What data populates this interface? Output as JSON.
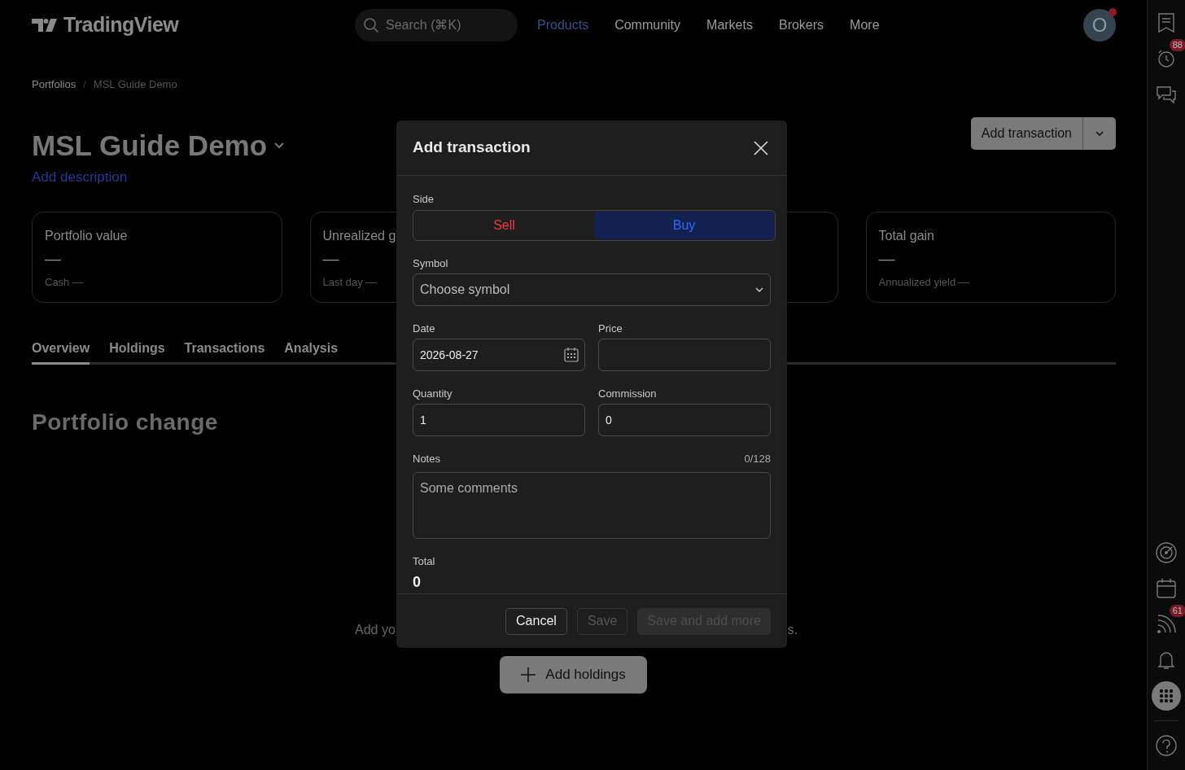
{
  "header": {
    "logo": "TradingView",
    "search": {
      "placeholder": "Search (⌘K)"
    },
    "nav": [
      {
        "label": "Products",
        "selected": true
      },
      {
        "label": "Community",
        "selected": false
      },
      {
        "label": "Markets",
        "selected": false
      },
      {
        "label": "Brokers",
        "selected": false
      },
      {
        "label": "More",
        "selected": false
      }
    ],
    "avatar": {
      "initial": "O"
    }
  },
  "right_toolbar": [
    {
      "kind": "watchlist",
      "selected": false
    },
    {
      "kind": "alerts",
      "badge": "88",
      "selected": false
    },
    {
      "kind": "chats",
      "selected": false
    },
    {
      "kind": "hotlist",
      "selected": false
    },
    {
      "kind": "calendar",
      "selected": false
    },
    {
      "kind": "news",
      "badge": "61",
      "selected": false
    },
    {
      "kind": "notifications",
      "selected": false
    },
    {
      "kind": "apps",
      "selected": true
    },
    {
      "kind": "help",
      "selected": false
    }
  ],
  "breadcrumbs": {
    "separator": "/",
    "items": [
      "Portfolios",
      "MSL Guide Demo"
    ]
  },
  "portfolio": {
    "title": "MSL Guide Demo",
    "add_description": "Add description",
    "add_transaction_button": "Add transaction"
  },
  "cards": [
    {
      "kind": "stat",
      "title": "Portfolio value",
      "value": "—",
      "subtitle": "Cash —"
    },
    {
      "kind": "stat",
      "title": "Unrealized g",
      "value": "—",
      "subtitle": "Last day —"
    },
    {
      "kind": "covered"
    },
    {
      "kind": "stat",
      "title": "Total gain",
      "value": "—",
      "subtitle": "Annualized yield —"
    }
  ],
  "tabs": [
    {
      "label": "Overview",
      "selected": true
    },
    {
      "label": "Holdings",
      "selected": false
    },
    {
      "label": "Transactions",
      "selected": false
    },
    {
      "label": "Analysis",
      "selected": false
    }
  ],
  "section_title": "Portfolio change",
  "empty_state": {
    "text_left": "Add yo",
    "text_right": "s.",
    "button": "Add holdings"
  },
  "dialog": {
    "title": "Add transaction",
    "side": {
      "label": "Side",
      "options": [
        {
          "label": "Sell",
          "kind": "sell",
          "selected": false
        },
        {
          "label": "Buy",
          "kind": "buy",
          "selected": true
        }
      ]
    },
    "symbol": {
      "label": "Symbol",
      "placeholder": "Choose symbol"
    },
    "fields": [
      {
        "label": "Date",
        "value": "2026-08-27",
        "kind": "date"
      },
      {
        "label": "Price",
        "kind": "text"
      },
      {
        "label": "Quantity",
        "value": "1",
        "kind": "text"
      },
      {
        "label": "Commission",
        "value": "0",
        "kind": "text"
      }
    ],
    "notes": {
      "label": "Notes",
      "counter": "0/128",
      "placeholder": "Some comments"
    },
    "total": {
      "label": "Total",
      "value": "0"
    },
    "buttons": [
      {
        "label": "Cancel",
        "kind": "outline",
        "disabled": false
      },
      {
        "label": "Save",
        "kind": "outline",
        "disabled": true
      },
      {
        "label": "Save and add more",
        "kind": "filled",
        "disabled": true
      }
    ]
  }
}
